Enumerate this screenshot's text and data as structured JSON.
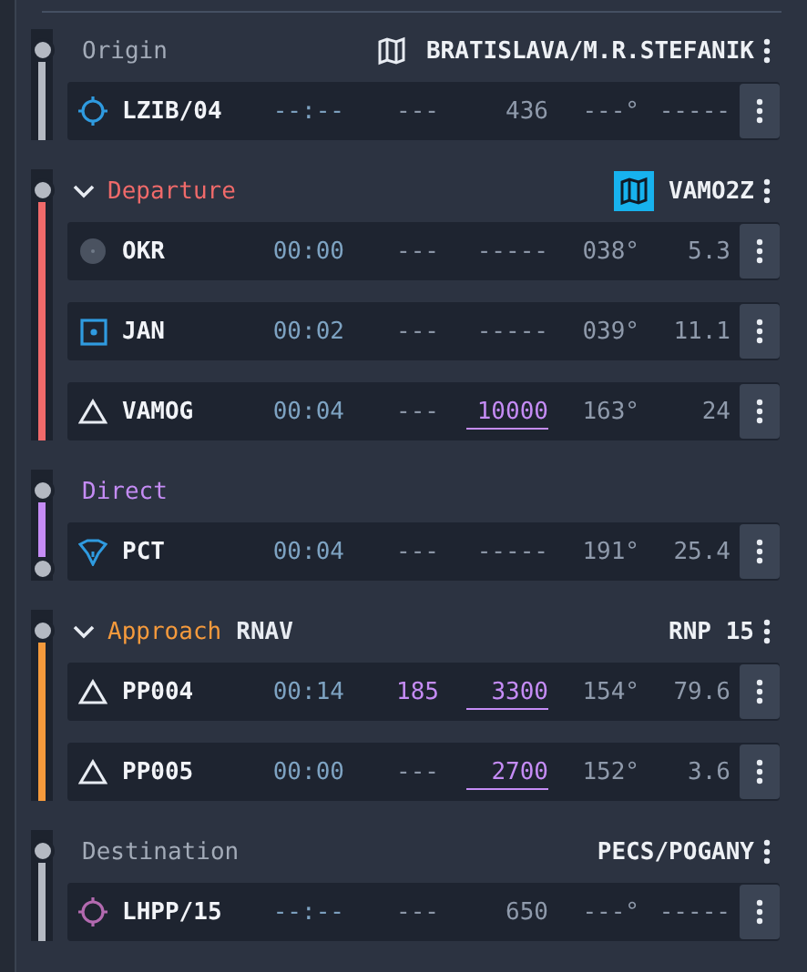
{
  "sections": [
    {
      "kind": "airport",
      "label": "Origin",
      "color": "#b4b9c2",
      "map": {
        "selected": false
      },
      "procedure": "BRATISLAVA/M.R.STEFANIK",
      "rows": [
        {
          "kind": "runway",
          "color": "#2f9be0",
          "ident": "LZIB/04",
          "time": "--:--",
          "speed": "---",
          "altitude": "436",
          "heading": "---°",
          "distance": "-----"
        }
      ]
    },
    {
      "kind": "procedure",
      "label": "Departure",
      "color": "#f06a6a",
      "expanded": true,
      "map": {
        "selected": true
      },
      "procedure": "VAMO2Z",
      "rows": [
        {
          "kind": "vor",
          "ident": "OKR",
          "time": "00:00",
          "speed": "---",
          "altitude": "-----",
          "heading": "038°",
          "distance": "5.3"
        },
        {
          "kind": "ndb",
          "ident": "JAN",
          "time": "00:02",
          "speed": "---",
          "altitude": "-----",
          "heading": "039°",
          "distance": "11.1"
        },
        {
          "kind": "fix",
          "ident": "VAMOG",
          "time": "00:04",
          "speed": "---",
          "altitude": "10000",
          "altitude_constraint": true,
          "heading": "163°",
          "distance": "24"
        }
      ]
    },
    {
      "kind": "direct",
      "label": "Direct",
      "color": "#c58cf5",
      "end_marker": true,
      "rows": [
        {
          "kind": "intersection",
          "ident": "PCT",
          "time": "00:04",
          "speed": "---",
          "altitude": "-----",
          "heading": "191°",
          "distance": "25.4"
        }
      ]
    },
    {
      "kind": "procedure",
      "label": "Approach",
      "color": "#f59a3c",
      "expanded": true,
      "subtitle": "RNAV",
      "procedure": "RNP 15",
      "rows": [
        {
          "kind": "fix",
          "ident": "PP004",
          "time": "00:14",
          "speed": "185",
          "speed_constraint": true,
          "altitude": "3300",
          "altitude_constraint": true,
          "heading": "154°",
          "distance": "79.6"
        },
        {
          "kind": "fix",
          "ident": "PP005",
          "time": "00:00",
          "speed": "---",
          "altitude": "2700",
          "altitude_constraint": true,
          "heading": "152°",
          "distance": "3.6"
        }
      ]
    },
    {
      "kind": "airport",
      "label": "Destination",
      "color": "#b4b9c2",
      "procedure": "PECS/POGANY",
      "rows": [
        {
          "kind": "runway",
          "color": "#b36ab0",
          "ident": "LHPP/15",
          "time": "--:--",
          "speed": "---",
          "altitude": "650",
          "heading": "---°",
          "distance": "-----"
        }
      ]
    }
  ]
}
